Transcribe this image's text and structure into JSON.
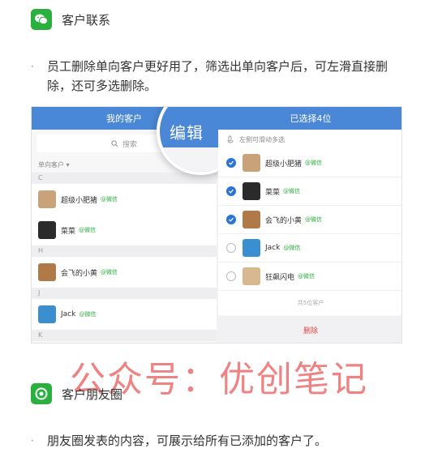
{
  "section1": {
    "title": "客户联系",
    "icon": "wechat-chat-icon"
  },
  "bullet1": {
    "text": "员工删除单向客户更好用了，筛选出单向客户后，可左滑直接删除，还可多选删除。"
  },
  "screenshot": {
    "left": {
      "header": "我的客户",
      "search_placeholder": "搜索",
      "filter": "单向客户",
      "groups": [
        {
          "letter": "C",
          "contacts": [
            {
              "name": "超级小肥猪",
              "tag": "@微信",
              "color": "#c9a27a"
            },
            {
              "name": "菜菜",
              "tag": "@微信",
              "color": "#2b2b2b"
            }
          ]
        },
        {
          "letter": "H",
          "contacts": [
            {
              "name": "会飞的小黄",
              "tag": "@微信",
              "color": "#b07a48"
            }
          ]
        },
        {
          "letter": "J",
          "contacts": [
            {
              "name": "Jack",
              "tag": "@微信",
              "color": "#3a8fd0"
            }
          ]
        },
        {
          "letter": "K",
          "contacts": []
        }
      ]
    },
    "magnifier_label": "编辑",
    "right": {
      "header": "已选择4位",
      "hint": "左侧可滑动多选",
      "contacts": [
        {
          "name": "超级小肥猪",
          "tag": "@微信",
          "checked": true,
          "color": "#c9a27a"
        },
        {
          "name": "菜菜",
          "tag": "@微信",
          "checked": true,
          "color": "#2b2b2b"
        },
        {
          "name": "会飞的小黄",
          "tag": "@微信",
          "checked": true,
          "color": "#b07a48"
        },
        {
          "name": "Jack",
          "tag": "@微信",
          "checked": false,
          "color": "#3a8fd0"
        },
        {
          "name": "狂飙闪电",
          "tag": "@微信",
          "checked": false,
          "color": "#d8b98f"
        }
      ],
      "count": "共5位客户",
      "delete_label": "删除"
    }
  },
  "watermark": "公众号：优创笔记",
  "section2": {
    "title": "客户朋友圈",
    "icon": "moments-camera-icon"
  },
  "bullet2": {
    "text": "朋友圈发表的内容，可展示给所有已添加的客户了。"
  },
  "colors": {
    "wechat_green": "#2ab03e",
    "header_blue": "#4a87d6",
    "check_blue": "#2a74d5",
    "delete_red": "#e24545"
  }
}
